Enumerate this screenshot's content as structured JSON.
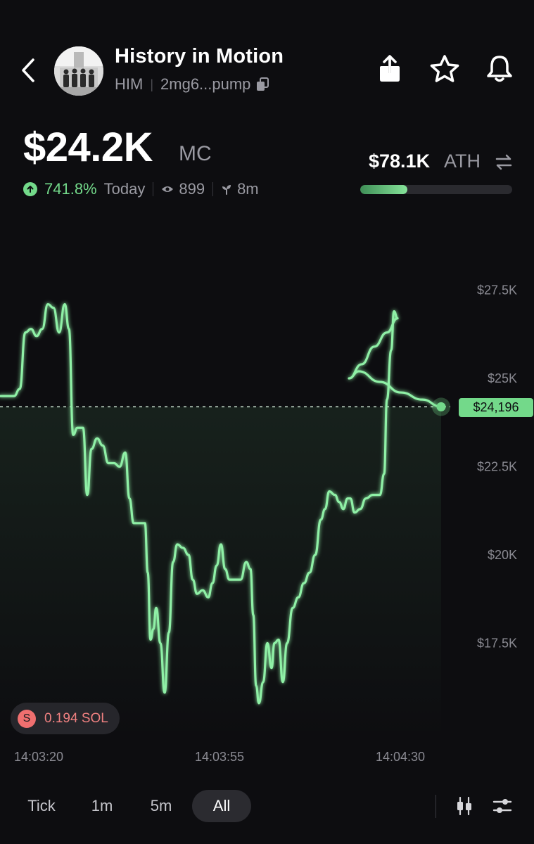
{
  "header": {
    "token_name": "History in Motion",
    "ticker": "HIM",
    "address": "2mg6...pump"
  },
  "market": {
    "mc_value": "$24.2K",
    "mc_unit": "MC",
    "change_pct": "741.8%",
    "change_period": "Today",
    "viewers": "899",
    "age": "8m",
    "ath_value": "$78.1K",
    "ath_label": "ATH",
    "ath_progress": 0.31
  },
  "chart_data": {
    "type": "line",
    "x_ticks": [
      "14:03:20",
      "14:03:55",
      "14:04:30"
    ],
    "y_ticks": [
      "$27.5K",
      "$25K",
      "$22.5K",
      "$20K",
      "$17.5K"
    ],
    "ylim": [
      15500,
      28500
    ],
    "current_price_label": "$24,196",
    "current_price": 24196,
    "series": [
      {
        "values": [
          [
            0,
            24.5
          ],
          [
            20,
            24.5
          ],
          [
            28,
            24.7
          ],
          [
            36,
            26.3
          ],
          [
            44,
            26.4
          ],
          [
            52,
            26.2
          ],
          [
            60,
            26.4
          ],
          [
            68,
            27.1
          ],
          [
            76,
            27.0
          ],
          [
            84,
            26.3
          ],
          [
            92,
            27.1
          ],
          [
            98,
            26.4
          ],
          [
            104,
            23.4
          ],
          [
            110,
            23.6
          ],
          [
            118,
            23.6
          ],
          [
            124,
            21.7
          ],
          [
            130,
            23.0
          ],
          [
            138,
            23.3
          ],
          [
            146,
            23.1
          ],
          [
            154,
            22.6
          ],
          [
            162,
            22.6
          ],
          [
            170,
            22.5
          ],
          [
            178,
            22.9
          ],
          [
            184,
            21.6
          ],
          [
            190,
            20.9
          ],
          [
            206,
            20.9
          ],
          [
            210,
            19.5
          ],
          [
            214,
            17.6
          ],
          [
            218,
            17.9
          ],
          [
            222,
            18.5
          ],
          [
            228,
            17.5
          ],
          [
            234,
            16.1
          ],
          [
            240,
            17.8
          ],
          [
            246,
            19.8
          ],
          [
            252,
            20.3
          ],
          [
            260,
            20.2
          ],
          [
            268,
            20.0
          ],
          [
            274,
            19.3
          ],
          [
            280,
            18.9
          ],
          [
            288,
            19.0
          ],
          [
            296,
            18.8
          ],
          [
            302,
            19.2
          ],
          [
            308,
            19.7
          ],
          [
            314,
            20.3
          ],
          [
            320,
            19.6
          ],
          [
            326,
            19.3
          ],
          [
            334,
            19.3
          ],
          [
            342,
            19.3
          ],
          [
            350,
            19.8
          ],
          [
            356,
            19.6
          ],
          [
            360,
            18.3
          ],
          [
            364,
            16.3
          ],
          [
            368,
            15.8
          ],
          [
            374,
            16.4
          ],
          [
            380,
            17.5
          ],
          [
            386,
            16.8
          ],
          [
            390,
            17.5
          ],
          [
            396,
            17.6
          ],
          [
            402,
            16.4
          ],
          [
            408,
            17.5
          ],
          [
            416,
            18.5
          ],
          [
            424,
            18.8
          ],
          [
            432,
            19.2
          ],
          [
            440,
            19.5
          ],
          [
            448,
            20.0
          ],
          [
            456,
            21.0
          ],
          [
            462,
            21.3
          ],
          [
            468,
            21.8
          ],
          [
            476,
            21.7
          ],
          [
            482,
            21.5
          ],
          [
            488,
            21.3
          ],
          [
            494,
            21.6
          ],
          [
            498,
            21.6
          ],
          [
            504,
            21.2
          ],
          [
            512,
            21.3
          ],
          [
            520,
            21.6
          ],
          [
            530,
            21.7
          ],
          [
            540,
            21.7
          ],
          [
            546,
            22.3
          ],
          [
            550,
            24.4
          ],
          [
            556,
            25.8
          ],
          [
            560,
            26.9
          ],
          [
            565,
            26.7
          ],
          [
            550,
            26.3
          ],
          [
            532,
            25.9
          ],
          [
            514,
            25.4
          ],
          [
            496,
            25.0
          ],
          [
            510,
            25.2
          ],
          [
            540,
            24.9
          ],
          [
            570,
            24.6
          ],
          [
            600,
            24.4
          ],
          [
            627,
            24.2
          ]
        ]
      }
    ]
  },
  "sell_marker": {
    "icon_letter": "S",
    "amount": "0.194 SOL"
  },
  "timeframes": [
    "Tick",
    "1m",
    "5m",
    "All"
  ],
  "active_timeframe": "All",
  "colors": {
    "background": "#0d0d10",
    "accent_green": "#73d98a",
    "sell_red": "#ef6f6f",
    "muted_text": "#9a9aa2"
  },
  "icons": {
    "back": "chevron-left-icon",
    "copy": "copy-icon",
    "share": "share-icon",
    "favorite": "star-icon",
    "alert": "bell-icon",
    "change": "arrow-up-circle-icon",
    "viewers": "eye-icon",
    "age": "sprout-icon",
    "swap": "swap-arrows-icon",
    "candles": "candlestick-icon",
    "settings": "sliders-icon"
  }
}
